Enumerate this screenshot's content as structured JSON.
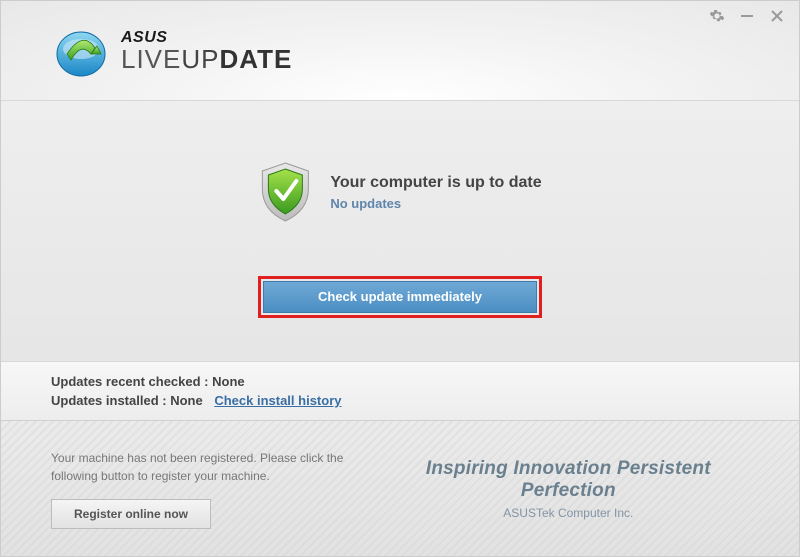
{
  "titlebar": {
    "settings": "⚙",
    "minimize": "—",
    "close": "✕"
  },
  "logo": {
    "brand": "ASUS",
    "product_part1": "LIVE",
    "product_part2": "UP",
    "product_part3": "DATE"
  },
  "status": {
    "title": "Your computer is up to date",
    "subtitle": "No updates"
  },
  "check_button": "Check update immediately",
  "info": {
    "recent_label": "Updates recent checked :",
    "recent_value": "None",
    "installed_label": "Updates installed :",
    "installed_value": "None",
    "history_link": "Check install history"
  },
  "footer": {
    "notice": "Your machine has not been registered. Please click the following button to register your machine.",
    "register_button": "Register online now",
    "slogan": "Inspiring Innovation  Persistent Perfection",
    "company": "ASUSTek Computer Inc."
  }
}
